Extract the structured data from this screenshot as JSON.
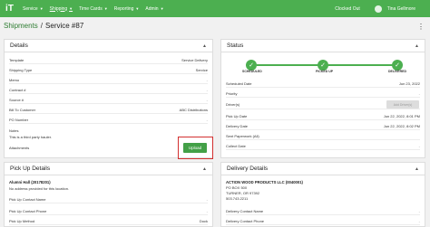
{
  "nav": {
    "logo": "iT",
    "items": [
      {
        "label": "Service"
      },
      {
        "label": "Shipping"
      },
      {
        "label": "Time Cards"
      },
      {
        "label": "Reporting"
      },
      {
        "label": "Admin"
      }
    ],
    "clocked_status": "Clocked Out",
    "user_name": "Tina Gellmore"
  },
  "breadcrumb": {
    "parent": "Shipments",
    "separator": "/",
    "current": "Service #87"
  },
  "details": {
    "title": "Details",
    "rows": [
      {
        "label": "Template",
        "value": "Service Delivery"
      },
      {
        "label": "Shipping Type",
        "value": "Service"
      },
      {
        "label": "Memo",
        "value": "-"
      },
      {
        "label": "Contract #",
        "value": "-"
      },
      {
        "label": "Source #",
        "value": "-"
      },
      {
        "label": "Bill To Customer",
        "value": "ABC Distributions"
      },
      {
        "label": "PO Number",
        "value": "-"
      }
    ],
    "notes_label": "Notes",
    "notes_text": "This is a third party hauler.",
    "attachments_label": "Attachments",
    "upload_label": "Upload"
  },
  "status": {
    "title": "Status",
    "steps": [
      "SCHEDULED",
      "PICKED UP",
      "DELIVERED"
    ],
    "rows": [
      {
        "label": "Scheduled Date",
        "value": "Jun 23, 2022"
      },
      {
        "label": "Priority",
        "value": "-"
      },
      {
        "label": "Driver(s)",
        "value": ""
      },
      {
        "label": "Pick Up Date",
        "value": "Jun 22, 2022, 8:01 PM"
      },
      {
        "label": "Delivery Date",
        "value": "Jun 22, 2022, 8:02 PM"
      },
      {
        "label": "Sent Paperwork (All)",
        "value": ""
      },
      {
        "label": "Collect Date",
        "value": "-"
      }
    ],
    "add_driver_label": "Add Driver(s)"
  },
  "pickup": {
    "title": "Pick Up Details",
    "name": "Alumni Hall (20178201)",
    "address": "No address provided for this location.",
    "rows": [
      {
        "label": "Pick Up Contact Name",
        "value": "-"
      },
      {
        "label": "Pick Up Contact Phone",
        "value": "-"
      },
      {
        "label": "Pick Up Method",
        "value": "Dock"
      }
    ]
  },
  "delivery": {
    "title": "Delivery Details",
    "name": "ACTION WOOD PRODUCTS LLC (0040001)",
    "address_lines": [
      "PO BOX 500",
      "TURNER, OR 97392",
      "503.743.2211"
    ],
    "rows": [
      {
        "label": "Delivery Contact Name",
        "value": "-"
      },
      {
        "label": "Delivery Contact Phone",
        "value": "-"
      }
    ]
  },
  "colors": {
    "brand": "#4caf50",
    "highlight": "#d32f2f"
  }
}
